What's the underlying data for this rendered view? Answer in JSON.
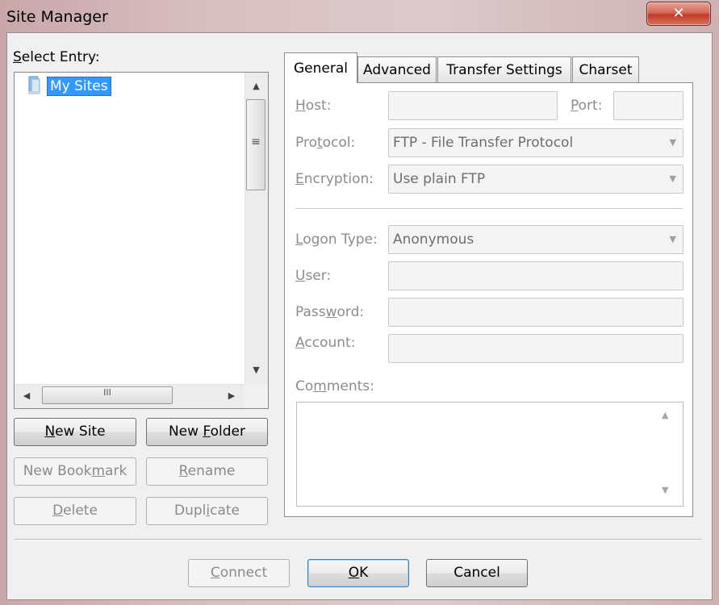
{
  "window": {
    "title": "Site Manager",
    "close_glyph": "✕"
  },
  "left": {
    "select_entry_label": "Select Entry:",
    "tree_root_label": "My Sites",
    "tree_root_icon": "folder-icon"
  },
  "left_buttons": {
    "new_site": "New Site",
    "new_folder": "New Folder",
    "new_bookmark": "New Bookmark",
    "rename": "Rename",
    "delete": "Delete",
    "duplicate": "Duplicate"
  },
  "tabs": [
    "General",
    "Advanced",
    "Transfer Settings",
    "Charset"
  ],
  "general": {
    "host_label": "Host:",
    "host_value": "",
    "port_label": "Port:",
    "port_value": "",
    "protocol_label": "Protocol:",
    "protocol_value": "FTP - File Transfer Protocol",
    "encryption_label": "Encryption:",
    "encryption_value": "Use plain FTP",
    "logon_type_label": "Logon Type:",
    "logon_type_value": "Anonymous",
    "user_label": "User:",
    "user_value": "",
    "password_label": "Password:",
    "password_value": "",
    "account_label": "Account:",
    "account_value": "",
    "comments_label": "Comments:",
    "comments_value": ""
  },
  "footer": {
    "connect": "Connect",
    "ok": "OK",
    "cancel": "Cancel"
  },
  "glyphs": {
    "up": "▲",
    "down": "▼",
    "left": "◀",
    "right": "▶",
    "dropdown": "▼",
    "vgrip": "≡",
    "hgrip": "III"
  },
  "colors": {
    "selection": "#3399ff",
    "disabled_text": "#8c8c8c",
    "close_button": "#c03b24"
  }
}
